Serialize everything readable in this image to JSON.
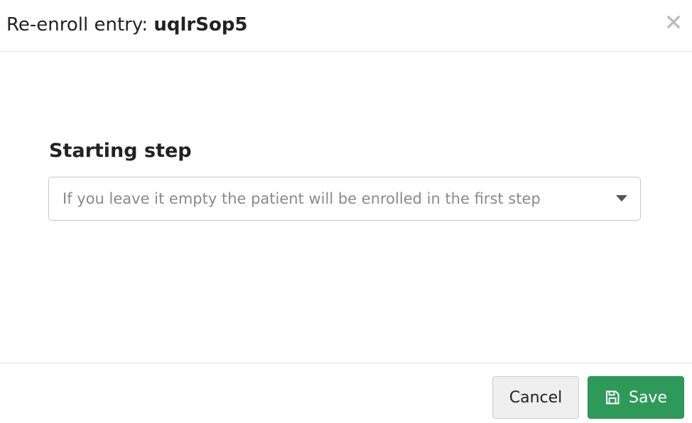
{
  "dialog": {
    "title_prefix": "Re-enroll entry: ",
    "entry_id": "uqlrSop5",
    "close_glyph": "X",
    "close_icon": "close-icon"
  },
  "form": {
    "starting_step_label": "Starting step",
    "starting_step_placeholder": "If you leave it empty the patient will be enrolled in the first step",
    "starting_step_value": ""
  },
  "footer": {
    "cancel_label": "Cancel",
    "save_label": "Save",
    "save_icon": "floppy-disk-icon"
  },
  "colors": {
    "save_button": "#2e9a5a",
    "cancel_button": "#efefef",
    "divider": "#e2e2e2",
    "placeholder_text": "#8a8a8a"
  }
}
